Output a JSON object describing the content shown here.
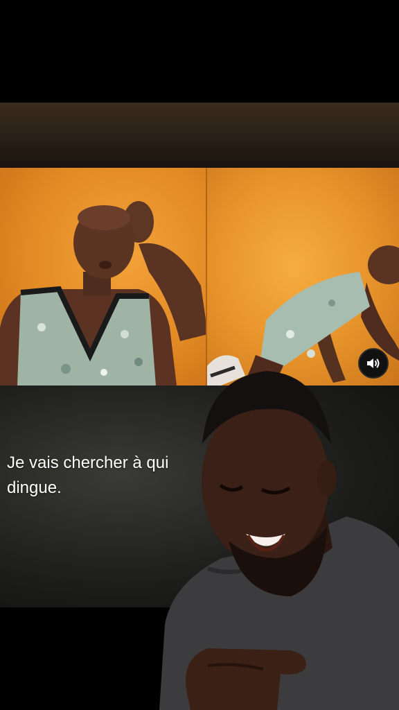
{
  "caption": {
    "line1": "Je vais chercher à qui",
    "line2": "dingue."
  },
  "controls": {
    "volume_icon": "speaker-volume-icon"
  },
  "colors": {
    "clip_background": "#e8912a",
    "sequin_top": "#9fb7a6",
    "reactor_shirt": "#3c3c3e"
  }
}
